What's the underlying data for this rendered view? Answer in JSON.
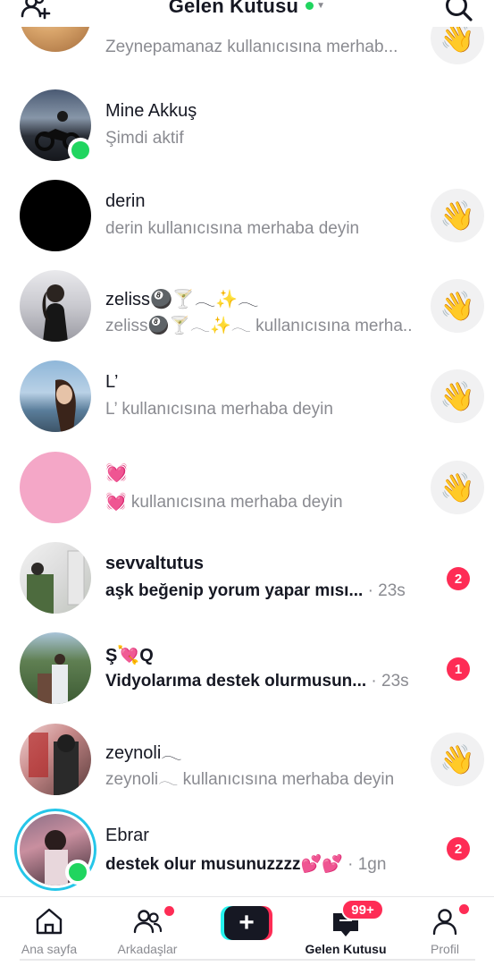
{
  "header": {
    "title": "Gelen Kutusu",
    "status_color": "#20d55f",
    "left_icon": "add-friends-icon",
    "right_icon": "search-icon"
  },
  "conversations": [
    {
      "name": "",
      "subtitle": "Zeynepamanaz kullanıcısına merhab...",
      "action": "wave"
    },
    {
      "name": "Mine Akkuş",
      "subtitle": "Şimdi aktif",
      "online": true
    },
    {
      "name": "derin",
      "subtitle": "derin kullanıcısına merhaba deyin",
      "action": "wave"
    },
    {
      "name": "zeliss🎱🍸𓂃✨𓂃",
      "subtitle": "zeliss🎱🍸𓂃✨𓂃 kullanıcısına merha...",
      "action": "wave"
    },
    {
      "name": "L’",
      "subtitle": "L’ kullanıcısına merhaba deyin",
      "action": "wave"
    },
    {
      "name": "💓",
      "subtitle": "💓 kullanıcısına merhaba deyin",
      "action": "wave"
    },
    {
      "name": "sevvaltutus",
      "subtitle": "aşk beğenip yorum yapar mısı...",
      "time": "· 23s",
      "unread": "2"
    },
    {
      "name": "Ş💘Q",
      "subtitle": "Vidyolarıma destek olurmusun...",
      "time": "· 23s",
      "unread": "1"
    },
    {
      "name": "zeynoli𓂃",
      "subtitle": "zeynoli𓂃 kullanıcısına merhaba deyin",
      "action": "wave"
    },
    {
      "name": "Ebrar",
      "subtitle": "destek olur musunuzzzz💕💕",
      "time": "· 1gn",
      "unread": "2",
      "online": true
    }
  ],
  "wave_glyph": "👋",
  "nav": {
    "home": "Ana sayfa",
    "friends": "Arkadaşlar",
    "create": "+",
    "inbox": "Gelen Kutusu",
    "inbox_badge": "99+",
    "profile": "Profil"
  },
  "colors": {
    "accent": "#fe2c55",
    "online": "#20d55f",
    "muted": "#8a8b91",
    "create_cyan": "#25f4ee",
    "create_red": "#fe2c55"
  }
}
